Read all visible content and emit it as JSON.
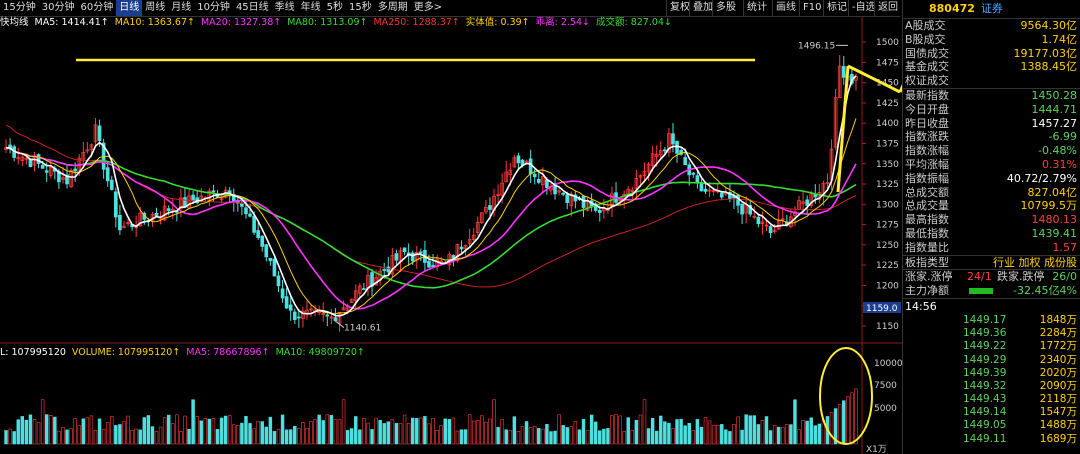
{
  "toolbar": {
    "timeframes": [
      "15分钟",
      "30分钟",
      "60分钟",
      "日线",
      "周线",
      "月线",
      "10分钟",
      "45日线",
      "季线",
      "年线",
      "5秒",
      "15秒",
      "多周期",
      "更多>"
    ],
    "active": "日线",
    "right_buttons": [
      "复权",
      "叠加",
      "多股",
      "统计",
      "画线",
      "F10",
      "标记",
      "-自选",
      "返回"
    ]
  },
  "legend": {
    "items": [
      {
        "label": "快均线",
        "color": "#ffffff"
      },
      {
        "label": "MA5: 1414.41↑",
        "color": "#ffffff"
      },
      {
        "label": "MA10: 1363.67↑",
        "color": "#ffd200"
      },
      {
        "label": "MA20: 1327.38↑",
        "color": "#ff33ff"
      },
      {
        "label": "MA80: 1313.09↑",
        "color": "#33dd33"
      },
      {
        "label": "MA250: 1288.37↑",
        "color": "#ff3333"
      },
      {
        "label": "实体值: 0.39↑",
        "color": "#ffd200"
      },
      {
        "label": "乖离: 2.54↓",
        "color": "#ff33ff"
      },
      {
        "label": "成交额: 827.04↓",
        "color": "#33dd33"
      }
    ]
  },
  "volume_legend": {
    "items": [
      {
        "label": "L: 107995120",
        "color": "#ffffff"
      },
      {
        "label": "VOLUME: 107995120↑",
        "color": "#ffd200"
      },
      {
        "label": "MA5: 78667896↑",
        "color": "#ff33ff"
      },
      {
        "label": "MA10: 49809720↑",
        "color": "#33dd33"
      }
    ]
  },
  "chart_data": {
    "type": "candlestick",
    "y_axis": {
      "ticks": [
        1150,
        1175,
        1200,
        1225,
        1250,
        1275,
        1300,
        1325,
        1350,
        1375,
        1400,
        1425,
        1450,
        1475,
        1500
      ],
      "ylim": [
        1145,
        1510
      ]
    },
    "volume_axis": {
      "ticks": [
        "5000",
        "7500",
        "10000"
      ],
      "unit": "X1万"
    },
    "annotations": {
      "high": "1496.15",
      "low": "1140.61",
      "current_price": "1159.0"
    },
    "ma_colors": {
      "ma5": "#ffffff",
      "ma10": "#ffd200",
      "ma20": "#ff33ff",
      "ma60": "#33dd33",
      "ma250": "#cc2222"
    }
  },
  "panel": {
    "code": "880472",
    "name": "证券",
    "rows1": [
      {
        "k": "A股成交",
        "v": "9564.30亿",
        "c": "#ffd200"
      },
      {
        "k": "B股成交",
        "v": "1.74亿",
        "c": "#ffd200"
      },
      {
        "k": "国债成交",
        "v": "19177.03亿",
        "c": "#ffd200"
      },
      {
        "k": "基金成交",
        "v": "1388.45亿",
        "c": "#ffd200"
      },
      {
        "k": "权证成交",
        "v": "",
        "c": "#ffd200"
      }
    ],
    "rows2": [
      {
        "k": "最新指数",
        "v": "1450.28",
        "c": "#5cd35c"
      },
      {
        "k": "今日开盘",
        "v": "1444.71",
        "c": "#5cd35c"
      },
      {
        "k": "昨日收盘",
        "v": "1457.27",
        "c": "#ffffff"
      },
      {
        "k": "指数涨跌",
        "v": "-6.99",
        "c": "#5cd35c"
      },
      {
        "k": "指数涨幅",
        "v": "-0.48%",
        "c": "#5cd35c"
      },
      {
        "k": "平均涨幅",
        "v": "0.31%",
        "c": "#ff4040"
      },
      {
        "k": "指数振幅",
        "v": "40.72/2.79%",
        "c": "#ffffff"
      },
      {
        "k": "总成交额",
        "v": "827.04亿",
        "c": "#ffd200"
      },
      {
        "k": "总成交量",
        "v": "10799.5万",
        "c": "#ffd200"
      },
      {
        "k": "最高指数",
        "v": "1480.13",
        "c": "#ff4040"
      },
      {
        "k": "最低指数",
        "v": "1439.41",
        "c": "#5cd35c"
      },
      {
        "k": "指数量比",
        "v": "1.57",
        "c": "#ff4040"
      }
    ],
    "board": {
      "k": "板指类型",
      "v": "行业 加权 成份股"
    },
    "updown": {
      "k1": "涨家.涨停",
      "v1": "24/1",
      "k2": "跌家.跌停",
      "v2": "26/0"
    },
    "flow": {
      "k": "主力净额",
      "v": "-32.45亿",
      "pct": "-4%"
    },
    "time": "14:56",
    "ticks": [
      {
        "p": "1449.17",
        "q": "1848万"
      },
      {
        "p": "1449.36",
        "q": "2284万"
      },
      {
        "p": "1449.22",
        "q": "1772万"
      },
      {
        "p": "1449.29",
        "q": "2340万"
      },
      {
        "p": "1449.39",
        "q": "2020万"
      },
      {
        "p": "1449.32",
        "q": "2090万"
      },
      {
        "p": "1449.43",
        "q": "2118万"
      },
      {
        "p": "1449.14",
        "q": "1547万"
      },
      {
        "p": "1449.05",
        "q": "1488万"
      },
      {
        "p": "1449.11",
        "q": "1689万"
      }
    ]
  }
}
